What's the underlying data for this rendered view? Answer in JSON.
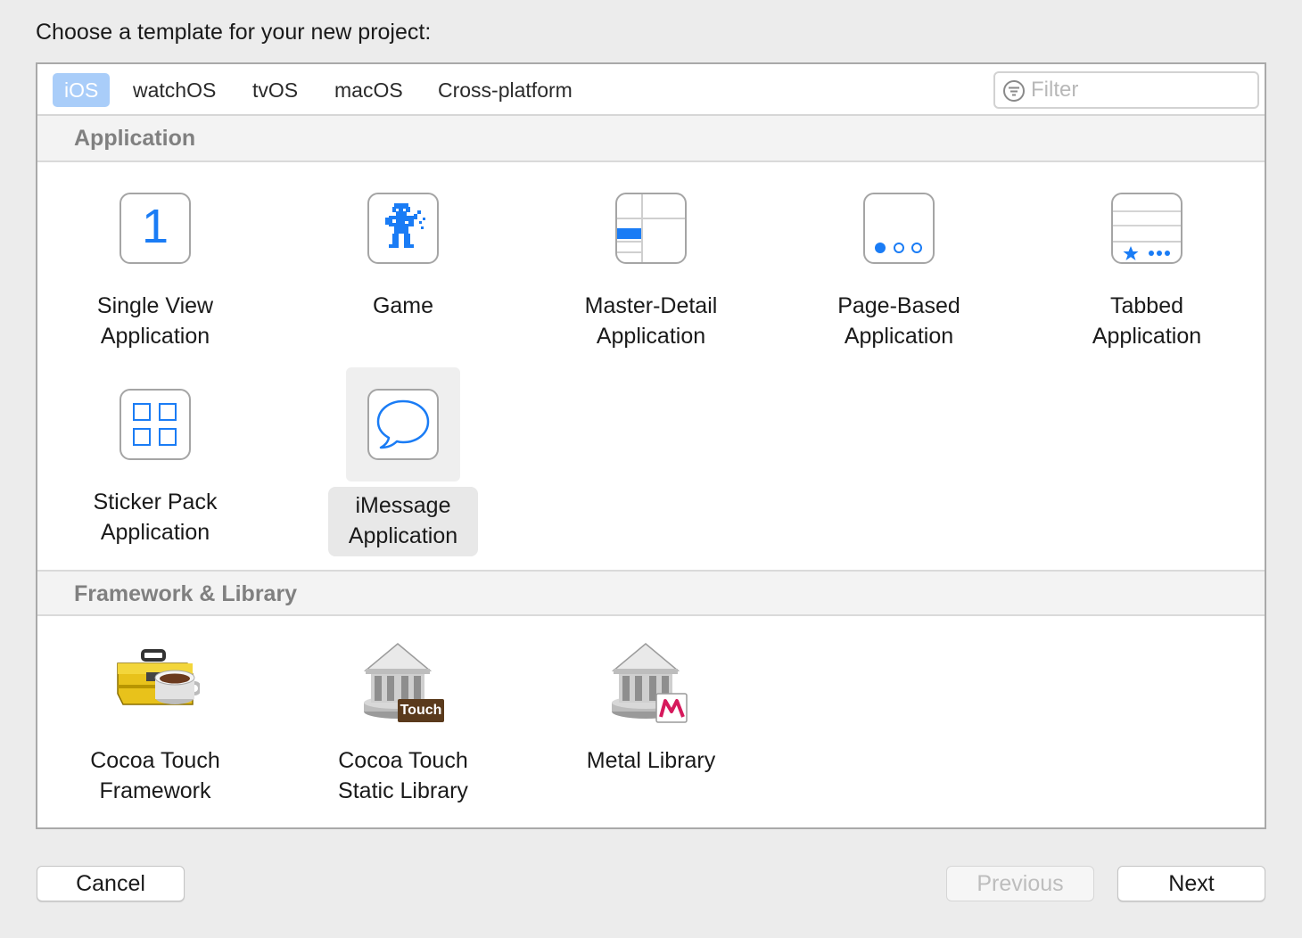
{
  "prompt": "Choose a template for your new project:",
  "tabs": [
    {
      "label": "iOS",
      "active": true
    },
    {
      "label": "watchOS"
    },
    {
      "label": "tvOS"
    },
    {
      "label": "macOS"
    },
    {
      "label": "Cross-platform"
    }
  ],
  "filter": {
    "placeholder": "Filter",
    "value": ""
  },
  "sections": {
    "application": {
      "title": "Application",
      "items": [
        {
          "line1": "Single View",
          "line2": "Application",
          "icon": "single-view-icon",
          "glyph": "1"
        },
        {
          "line1": "Game",
          "line2": "",
          "icon": "game-icon"
        },
        {
          "line1": "Master-Detail",
          "line2": "Application",
          "icon": "master-detail-icon"
        },
        {
          "line1": "Page-Based",
          "line2": "Application",
          "icon": "page-based-icon"
        },
        {
          "line1": "Tabbed",
          "line2": "Application",
          "icon": "tabbed-icon"
        },
        {
          "line1": "Sticker Pack",
          "line2": "Application",
          "icon": "sticker-pack-icon"
        },
        {
          "line1": "iMessage",
          "line2": "Application",
          "icon": "imessage-icon",
          "selected": true
        }
      ]
    },
    "framework": {
      "title": "Framework & Library",
      "items": [
        {
          "line1": "Cocoa Touch",
          "line2": "Framework",
          "icon": "toolbox-icon"
        },
        {
          "line1": "Cocoa Touch",
          "line2": "Static Library",
          "icon": "static-library-icon",
          "badge": "Touch"
        },
        {
          "line1": "Metal Library",
          "line2": "",
          "icon": "metal-library-icon"
        }
      ]
    }
  },
  "buttons": {
    "cancel": "Cancel",
    "previous": "Previous",
    "next": "Next"
  },
  "colors": {
    "accent": "#1a7cf5",
    "tab_active_bg": "#a9cdf9"
  }
}
